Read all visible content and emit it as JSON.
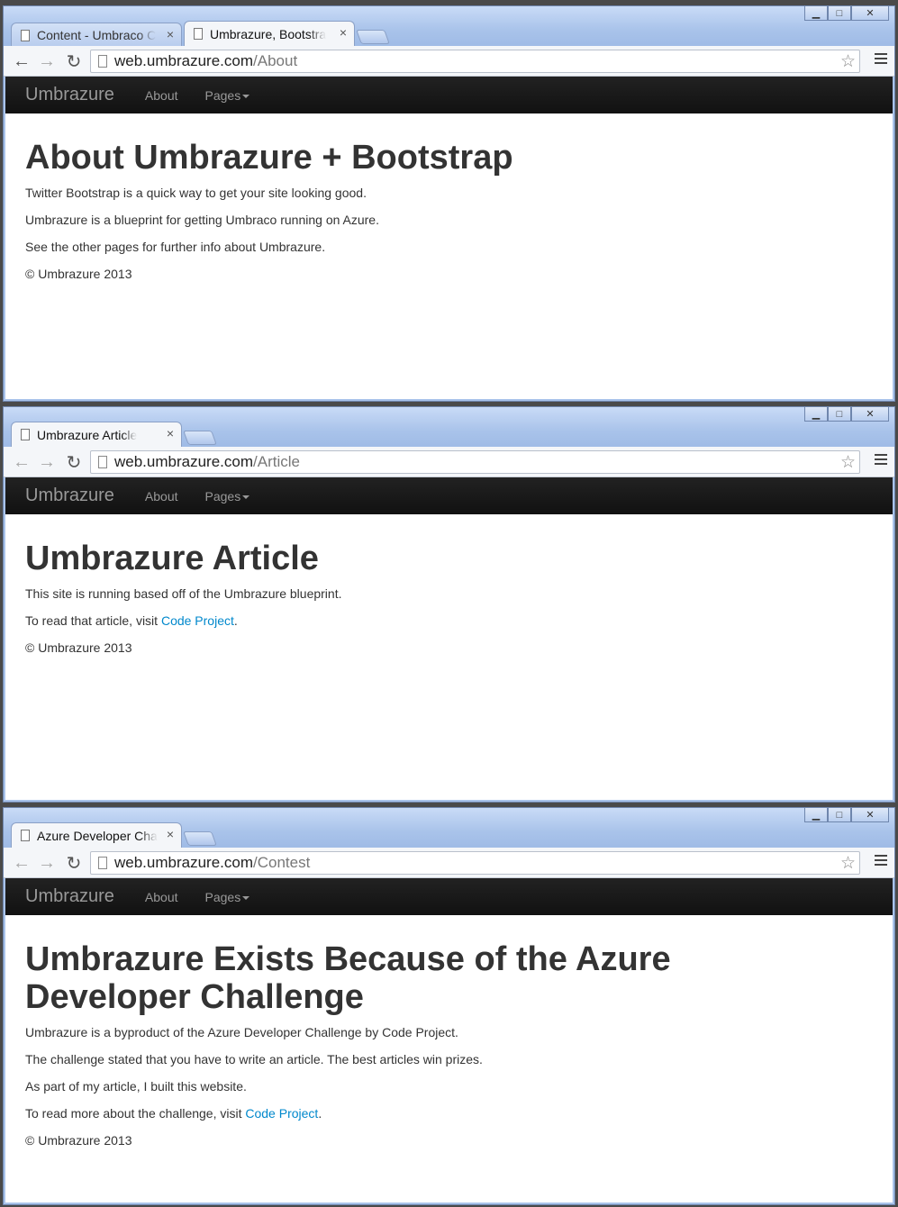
{
  "windows": [
    {
      "tabs": [
        {
          "title": "Content - Umbraco C",
          "active": false
        },
        {
          "title": "Umbrazure, Bootstra",
          "active": true
        }
      ],
      "url_host": "web.umbrazure.com",
      "url_path": "/About",
      "brand": "Umbrazure",
      "nav": {
        "about": "About",
        "pages": "Pages"
      },
      "heading": "About Umbrazure + Bootstrap",
      "paragraphs": [
        "Twitter Bootstrap is a quick way to get your site looking good.",
        "Umbrazure is a blueprint for getting Umbraco running on Azure.",
        "See the other pages for further info about Umbrazure.",
        "© Umbrazure 2013"
      ]
    },
    {
      "tabs": [
        {
          "title": "Umbrazure Article",
          "active": true
        }
      ],
      "url_host": "web.umbrazure.com",
      "url_path": "/Article",
      "brand": "Umbrazure",
      "nav": {
        "about": "About",
        "pages": "Pages"
      },
      "heading": "Umbrazure Article",
      "p1": "This site is running based off of the Umbrazure blueprint.",
      "p2_prefix": "To read that article, visit ",
      "p2_link": "Code Project",
      "p2_suffix": ".",
      "footer": "© Umbrazure 2013"
    },
    {
      "tabs": [
        {
          "title": "Azure Developer Cha",
          "active": true
        }
      ],
      "url_host": "web.umbrazure.com",
      "url_path": "/Contest",
      "brand": "Umbrazure",
      "nav": {
        "about": "About",
        "pages": "Pages"
      },
      "heading": "Umbrazure Exists Because of the Azure Developer Challenge",
      "paragraphs": [
        "Umbrazure is a byproduct of the Azure Developer Challenge by Code Project.",
        "The challenge stated that you have to write an article. The best articles win prizes.",
        "As part of my article, I built this website."
      ],
      "p4_prefix": "To read more about the challenge, visit ",
      "p4_link": "Code Project",
      "p4_suffix": ".",
      "footer": "© Umbrazure 2013"
    }
  ],
  "icons": {
    "close_tab": "×",
    "back": "←",
    "forward": "→",
    "reload": "↻",
    "star": "☆",
    "minimize": "▁",
    "maximize": "□",
    "close_window": "✕"
  },
  "colors": {
    "link": "#0088cc",
    "navbar": "#1b1b1b",
    "frame": "#a9c3ea"
  }
}
